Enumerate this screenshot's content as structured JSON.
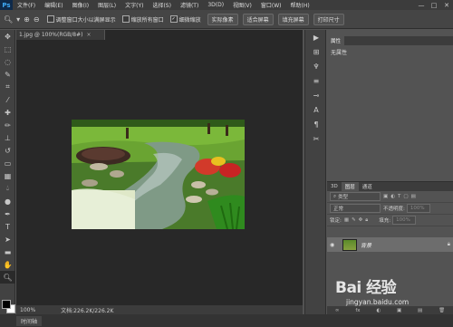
{
  "app": {
    "logo": "Ps"
  },
  "menubar": {
    "items": [
      "文件(F)",
      "编辑(E)",
      "图像(I)",
      "图层(L)",
      "文字(Y)",
      "选择(S)",
      "滤镜(T)",
      "3D(D)",
      "视图(V)",
      "窗口(W)",
      "帮助(H)"
    ],
    "window_controls": [
      "—",
      "□",
      "✕"
    ]
  },
  "options_bar": {
    "checkboxes": [
      {
        "label": "调整窗口大小以满屏显示",
        "checked": false
      },
      {
        "label": "缩放所有窗口",
        "checked": false
      },
      {
        "label": "细微缩放",
        "checked": true
      }
    ],
    "buttons": [
      "实际像素",
      "适合屏幕",
      "填充屏幕",
      "打印尺寸"
    ]
  },
  "document": {
    "tab_title": "1.jpg @ 100%(RGB/8#)",
    "tab_close": "×",
    "zoom": "100%",
    "doc_info": "文档:226.2K/226.2K"
  },
  "bottom": {
    "timeline_label": "时间轴"
  },
  "properties_panel": {
    "tab": "属性",
    "empty_text": "无属性"
  },
  "layers_panel": {
    "tabs": [
      "3D",
      "图层",
      "通道"
    ],
    "filter_kind": "类型",
    "blend_mode": "正常",
    "opacity_label": "不透明度:",
    "opacity_value": "100%",
    "lock_label": "锁定:",
    "fill_label": "填充:",
    "fill_value": "100%",
    "layer_name": "背景",
    "footer_icons": [
      "∞",
      "fx",
      "◐",
      "▣",
      "▤",
      "🗑"
    ]
  },
  "watermark": {
    "text": "Bai 经验",
    "url": "jingyan.baidu.com"
  },
  "colors": {
    "ui_dark": "#3c3c3c",
    "ui_panel": "#535353",
    "doc_bg": "#282828",
    "ps_blue": "#3fa9f5"
  }
}
